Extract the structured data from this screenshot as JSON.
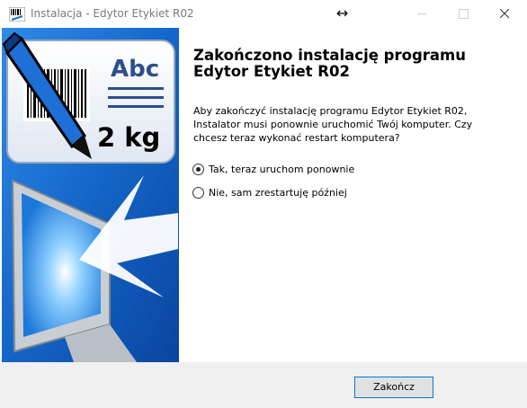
{
  "window": {
    "title": "Instalacja - Edytor Etykiet R02",
    "icon": "app-barcode-icon",
    "controls": [
      "resize-icon",
      "minimize-icon",
      "maximize-icon",
      "close-icon"
    ]
  },
  "banner": {
    "label_text": "Abc",
    "weight_text": "2 kg"
  },
  "content": {
    "heading": "Zakończono instalację programu Edytor Etykiet R02",
    "description": "Aby zakończyć instalację programu Edytor Etykiet R02, Instalator musi ponownie uruchomić Twój komputer. Czy chcesz teraz wykonać restart komputera?",
    "options": [
      {
        "label": "Tak, teraz uruchom ponownie",
        "checked": true
      },
      {
        "label": "Nie, sam zrestartuję później",
        "checked": false
      }
    ]
  },
  "footer": {
    "finish_label": "Zakończ"
  },
  "colors": {
    "banner_blue": "#1a6fd0",
    "button_border": "#0078d7"
  }
}
